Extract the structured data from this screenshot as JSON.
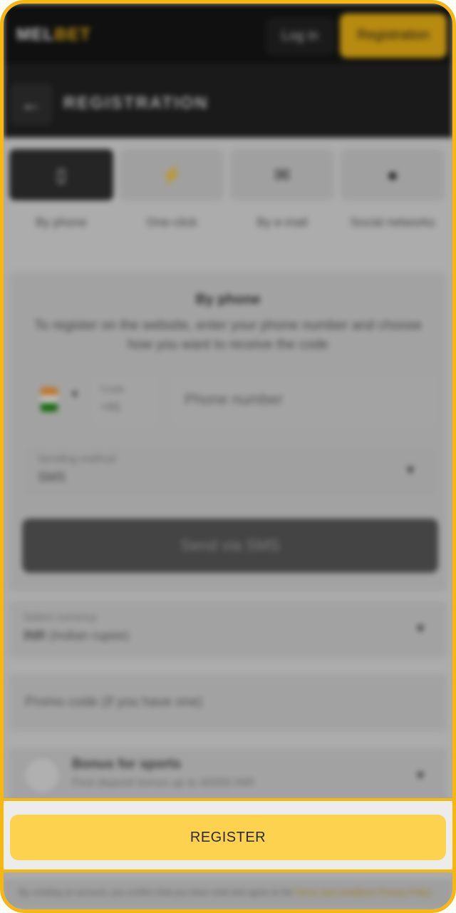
{
  "header": {
    "logo_part1": "MEL",
    "logo_part2": "BET",
    "login_label": "Log in",
    "registration_label": "Registration"
  },
  "page": {
    "title": "REGISTRATION"
  },
  "tabs": [
    {
      "label": "By phone",
      "icon": "phone-icon",
      "active": true
    },
    {
      "label": "One-click",
      "icon": "lightning-icon",
      "active": false
    },
    {
      "label": "By e-mail",
      "icon": "envelope-icon",
      "active": false
    },
    {
      "label": "Social networks",
      "icon": "social-icon",
      "active": false
    }
  ],
  "phone_form": {
    "title": "By phone",
    "description": "To register on the website, enter your phone number and choose how you want to receive the code",
    "code_label": "Code",
    "code_value": "+91",
    "phone_placeholder": "Phone number",
    "method_label": "Sending method",
    "method_value": "SMS",
    "send_button": "Send via SMS"
  },
  "currency": {
    "label": "Select currency",
    "code": "INR",
    "name": "(Indian rupee)"
  },
  "promo": {
    "placeholder": "Promo code (if you have one)"
  },
  "bonus": {
    "title": "Bonus for sports",
    "subtitle": "First deposit bonus up to 40000 INR"
  },
  "footer": {
    "text": "By creating an account, you confirm that you have read and agree to the",
    "link1": "Terms and conditions",
    "link2": "Privacy Policy"
  },
  "register_button": "REGISTER",
  "colors": {
    "accent": "#f6b80f",
    "register_button": "#fdd24e",
    "dark": "#0e0e0e"
  }
}
